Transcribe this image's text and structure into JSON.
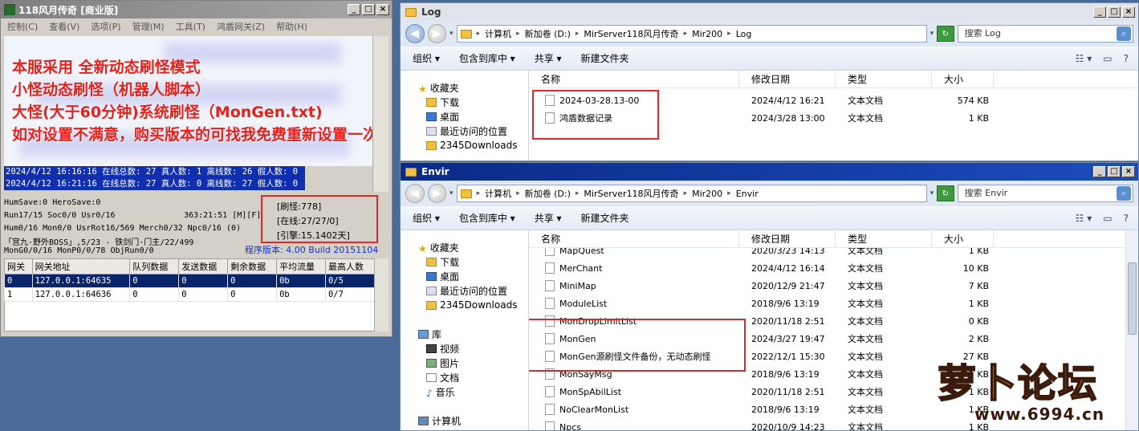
{
  "server": {
    "title": "118风月传奇 [商业版]",
    "menu": [
      "控制(C)",
      "查看(V)",
      "选项(P)",
      "管理(M)",
      "工具(T)",
      "鸿盾网关(Z)",
      "帮助(H)"
    ],
    "promo": [
      "本服采用 全新动态刷怪模式",
      "小怪动态刷怪（机器人脚本）",
      "大怪(大于60分钟)系统刷怪（MonGen.txt)",
      "如对设置不满意，购买版本的可找我免费重新设置一次"
    ],
    "log_lines": [
      "2024/4/12 16:16:16 在线总数: 27 真人数: 1 离线数: 26 假人数: 0",
      "2024/4/12 16:21:16 在线总数: 27 真人数: 0 离线数: 27 假人数: 0"
    ],
    "stats": [
      "HumSave:0 HeroSave:0",
      "Run17/15 Soc0/0 Usr0/16",
      "Hum0/16 Mon0/0 UsrRot16/569 Merch0/32 Npc0/16 (0)",
      "「宫九·野外BOSS」,5/23 - 铁剑门·门主/22/499",
      "MonG0/0/16 MonP0/0/78 ObjRun0/0"
    ],
    "time_stat": "363:21:51 [M][F]",
    "box": [
      "[刷怪:778]",
      "[在线:27/27/0]",
      "[引擎:15.1402天]"
    ],
    "version": "程序版本: 4.00 Build 20151104",
    "gateway_headers": [
      "网关",
      "网关地址",
      "队列数据",
      "发送数据",
      "剩余数据",
      "平均流量",
      "最高人数"
    ],
    "gateway_rows": [
      [
        "0",
        "127.0.0.1:64635",
        "0",
        "0",
        "0",
        "0b",
        "0/5"
      ],
      [
        "1",
        "127.0.0.1:64636",
        "0",
        "0",
        "0",
        "0b",
        "0/7"
      ]
    ]
  },
  "explorer_log": {
    "title": "Log",
    "path": [
      "计算机",
      "新加卷 (D:)",
      "MirServer118风月传奇",
      "Mir200",
      "Log"
    ],
    "search": "搜索 Log",
    "toolbar": [
      "组织 ▾",
      "包含到库中 ▾",
      "共享 ▾",
      "新建文件夹"
    ],
    "nav": [
      {
        "label": "收藏夹",
        "icon": "star-icon",
        "level": 1
      },
      {
        "label": "下载",
        "icon": "download-folder-icon",
        "level": 2
      },
      {
        "label": "桌面",
        "icon": "desktop-icon",
        "level": 2
      },
      {
        "label": "最近访问的位置",
        "icon": "recent-places-icon",
        "level": 2
      },
      {
        "label": "2345Downloads",
        "icon": "folder-icon",
        "level": 2
      }
    ],
    "columns": [
      "名称",
      "修改日期",
      "类型",
      "大小"
    ],
    "files": [
      {
        "name": "2024-03-28.13-00",
        "date": "2024/4/12 16:21",
        "type": "文本文档",
        "size": "574 KB"
      },
      {
        "name": "鸿盾数据记录",
        "date": "2024/3/28 13:00",
        "type": "文本文档",
        "size": "1 KB"
      }
    ]
  },
  "explorer_envir": {
    "title": "Envir",
    "path": [
      "计算机",
      "新加卷 (D:)",
      "MirServer118风月传奇",
      "Mir200",
      "Envir"
    ],
    "search": "搜索 Envir",
    "toolbar": [
      "组织 ▾",
      "包含到库中 ▾",
      "共享 ▾",
      "新建文件夹"
    ],
    "nav": [
      {
        "label": "收藏夹",
        "icon": "star-icon",
        "level": 1
      },
      {
        "label": "下载",
        "icon": "download-folder-icon",
        "level": 2
      },
      {
        "label": "桌面",
        "icon": "desktop-icon",
        "level": 2
      },
      {
        "label": "最近访问的位置",
        "icon": "recent-places-icon",
        "level": 2
      },
      {
        "label": "2345Downloads",
        "icon": "folder-icon",
        "level": 2
      },
      {
        "label": "",
        "icon": "",
        "level": 0
      },
      {
        "label": "库",
        "icon": "library-icon",
        "level": 1
      },
      {
        "label": "视频",
        "icon": "video-icon",
        "level": 2
      },
      {
        "label": "图片",
        "icon": "pictures-icon",
        "level": 2
      },
      {
        "label": "文档",
        "icon": "documents-icon",
        "level": 2
      },
      {
        "label": "音乐",
        "icon": "music-icon",
        "level": 2
      },
      {
        "label": "",
        "icon": "",
        "level": 0
      },
      {
        "label": "计算机",
        "icon": "computer-icon",
        "level": 1
      }
    ],
    "columns": [
      "名称",
      "修改日期",
      "类型",
      "大小"
    ],
    "files": [
      {
        "name": "MapQuest",
        "date": "2020/3/23 14:13",
        "type": "文本文档",
        "size": "1 KB"
      },
      {
        "name": "MerChant",
        "date": "2024/4/12 16:14",
        "type": "文本文档",
        "size": "10 KB"
      },
      {
        "name": "MiniMap",
        "date": "2020/12/9 21:47",
        "type": "文本文档",
        "size": "7 KB"
      },
      {
        "name": "ModuleList",
        "date": "2018/9/6 13:19",
        "type": "文本文档",
        "size": "1 KB"
      },
      {
        "name": "MonDropLimitList",
        "date": "2020/11/18 2:51",
        "type": "文本文档",
        "size": "0 KB"
      },
      {
        "name": "MonGen",
        "date": "2024/3/27 19:47",
        "type": "文本文档",
        "size": "2 KB"
      },
      {
        "name": "MonGen源刷怪文件备份，无动态刷怪",
        "date": "2022/12/1 15:30",
        "type": "文本文档",
        "size": "27 KB"
      },
      {
        "name": "MonSayMsg",
        "date": "2018/9/6 13:19",
        "type": "文本文档",
        "size": "1 KB"
      },
      {
        "name": "MonSpAbilList",
        "date": "2020/11/18 2:51",
        "type": "文本文档",
        "size": "1 KB"
      },
      {
        "name": "NoClearMonList",
        "date": "2018/9/6 13:19",
        "type": "文本文档",
        "size": "1 KB"
      },
      {
        "name": "Npcs",
        "date": "2020/10/9 14:23",
        "type": "文本文档",
        "size": "1 KB"
      }
    ]
  },
  "logo": {
    "text": "萝卜论坛",
    "url": "www.6994.cn"
  },
  "colors": {
    "highlight_box": "#e0282a",
    "log_bg": "#0f2fb0",
    "promo_text": "#e8201c",
    "version_text": "#1533c9"
  }
}
